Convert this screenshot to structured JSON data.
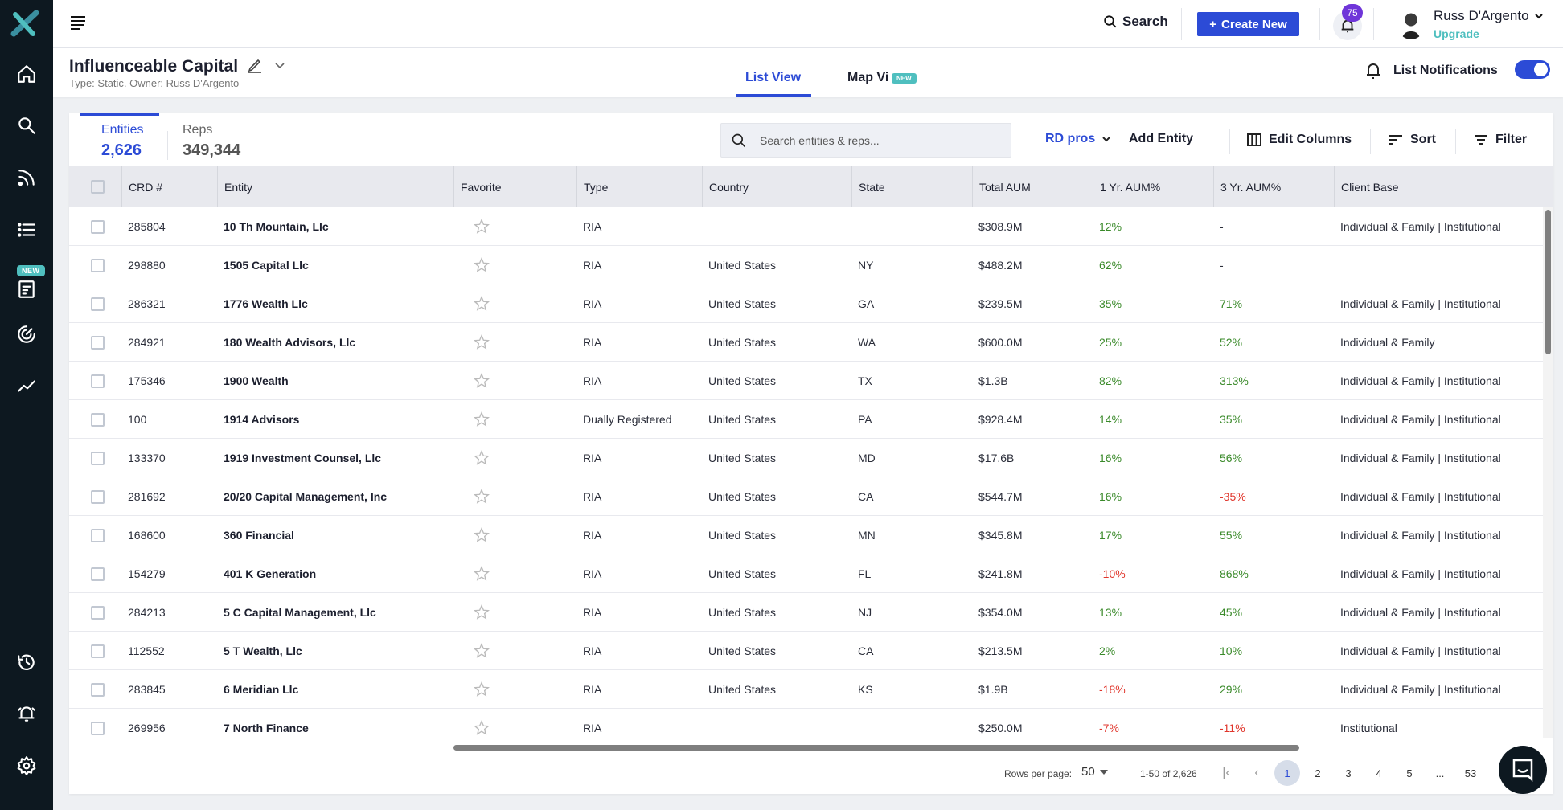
{
  "sidebar": {
    "items": [
      {
        "name": "home",
        "icon": "home-icon"
      },
      {
        "name": "search",
        "icon": "search-icon"
      },
      {
        "name": "feed",
        "icon": "rss-feed-icon"
      },
      {
        "name": "lists",
        "icon": "list-icon"
      },
      {
        "name": "reports",
        "icon": "report-icon",
        "badge": "NEW"
      },
      {
        "name": "radar",
        "icon": "radar-icon"
      },
      {
        "name": "analytics",
        "icon": "trend-icon"
      },
      {
        "name": "history",
        "icon": "history-icon"
      },
      {
        "name": "alerts",
        "icon": "alarm-bell-icon"
      },
      {
        "name": "settings",
        "icon": "gear-icon"
      }
    ],
    "new_badge": "NEW"
  },
  "topbar": {
    "search_label": "Search",
    "create_label": "Create New",
    "notification_count": "75",
    "user_name": "Russ D'Argento",
    "upgrade_label": "Upgrade"
  },
  "list_header": {
    "title": "Influenceable Capital",
    "meta": "Type: Static. Owner: Russ D'Argento",
    "tabs": [
      {
        "label": "List View",
        "active": true
      },
      {
        "label": "Map Vi",
        "badge": "NEW"
      }
    ],
    "notifications_label": "List Notifications",
    "notifications_on": true
  },
  "counts": {
    "entities_label": "Entities",
    "entities_value": "2,626",
    "reps_label": "Reps",
    "reps_value": "349,344"
  },
  "toolbar": {
    "search_placeholder": "Search entities & reps...",
    "rd_pros_label": "RD pros",
    "add_entity_label": "Add Entity",
    "edit_columns_label": "Edit Columns",
    "sort_label": "Sort",
    "filter_label": "Filter"
  },
  "table": {
    "columns": [
      "CRD #",
      "Entity",
      "Favorite",
      "Type",
      "Country",
      "State",
      "Total AUM",
      "1 Yr. AUM%",
      "3 Yr. AUM%",
      "Client Base"
    ],
    "rows": [
      {
        "crd": "285804",
        "entity": "10 Th Mountain, Llc",
        "type": "RIA",
        "country": "",
        "state": "",
        "aum": "$308.9M",
        "y1": "12%",
        "y3": "-",
        "client": "Individual & Family | Institutional"
      },
      {
        "crd": "298880",
        "entity": "1505 Capital Llc",
        "type": "RIA",
        "country": "United States",
        "state": "NY",
        "aum": "$488.2M",
        "y1": "62%",
        "y3": "-",
        "client": ""
      },
      {
        "crd": "286321",
        "entity": "1776 Wealth Llc",
        "type": "RIA",
        "country": "United States",
        "state": "GA",
        "aum": "$239.5M",
        "y1": "35%",
        "y3": "71%",
        "client": "Individual & Family | Institutional"
      },
      {
        "crd": "284921",
        "entity": "180 Wealth Advisors, Llc",
        "type": "RIA",
        "country": "United States",
        "state": "WA",
        "aum": "$600.0M",
        "y1": "25%",
        "y3": "52%",
        "client": "Individual & Family"
      },
      {
        "crd": "175346",
        "entity": "1900 Wealth",
        "type": "RIA",
        "country": "United States",
        "state": "TX",
        "aum": "$1.3B",
        "y1": "82%",
        "y3": "313%",
        "client": "Individual & Family | Institutional"
      },
      {
        "crd": "100",
        "entity": "1914 Advisors",
        "type": "Dually Registered",
        "country": "United States",
        "state": "PA",
        "aum": "$928.4M",
        "y1": "14%",
        "y3": "35%",
        "client": "Individual & Family | Institutional"
      },
      {
        "crd": "133370",
        "entity": "1919 Investment Counsel, Llc",
        "type": "RIA",
        "country": "United States",
        "state": "MD",
        "aum": "$17.6B",
        "y1": "16%",
        "y3": "56%",
        "client": "Individual & Family | Institutional"
      },
      {
        "crd": "281692",
        "entity": "20/20 Capital Management, Inc",
        "type": "RIA",
        "country": "United States",
        "state": "CA",
        "aum": "$544.7M",
        "y1": "16%",
        "y3": "-35%",
        "client": "Individual & Family | Institutional"
      },
      {
        "crd": "168600",
        "entity": "360 Financial",
        "type": "RIA",
        "country": "United States",
        "state": "MN",
        "aum": "$345.8M",
        "y1": "17%",
        "y3": "55%",
        "client": "Individual & Family | Institutional"
      },
      {
        "crd": "154279",
        "entity": "401 K Generation",
        "type": "RIA",
        "country": "United States",
        "state": "FL",
        "aum": "$241.8M",
        "y1": "-10%",
        "y3": "868%",
        "client": "Individual & Family | Institutional"
      },
      {
        "crd": "284213",
        "entity": "5 C Capital Management, Llc",
        "type": "RIA",
        "country": "United States",
        "state": "NJ",
        "aum": "$354.0M",
        "y1": "13%",
        "y3": "45%",
        "client": "Individual & Family | Institutional"
      },
      {
        "crd": "112552",
        "entity": "5 T Wealth, Llc",
        "type": "RIA",
        "country": "United States",
        "state": "CA",
        "aum": "$213.5M",
        "y1": "2%",
        "y3": "10%",
        "client": "Individual & Family | Institutional"
      },
      {
        "crd": "283845",
        "entity": "6 Meridian Llc",
        "type": "RIA",
        "country": "United States",
        "state": "KS",
        "aum": "$1.9B",
        "y1": "-18%",
        "y3": "29%",
        "client": "Individual & Family | Institutional"
      },
      {
        "crd": "269956",
        "entity": "7 North Finance",
        "type": "RIA",
        "country": "",
        "state": "",
        "aum": "$250.0M",
        "y1": "-7%",
        "y3": "-11%",
        "client": "Institutional"
      }
    ]
  },
  "pagination": {
    "rows_per_page_label": "Rows per page:",
    "rows_per_page": "50",
    "range": "1-50 of 2,626",
    "pages": [
      "1",
      "2",
      "3",
      "4",
      "5",
      "...",
      "53"
    ],
    "current_page": "1"
  },
  "colors": {
    "accent": "#2c4bd6",
    "teal": "#4fbfbf",
    "positive": "#3a8a2a",
    "negative": "#e0352b",
    "sidebar_bg": "#0d1820",
    "badge_purple": "#6f35d9"
  }
}
